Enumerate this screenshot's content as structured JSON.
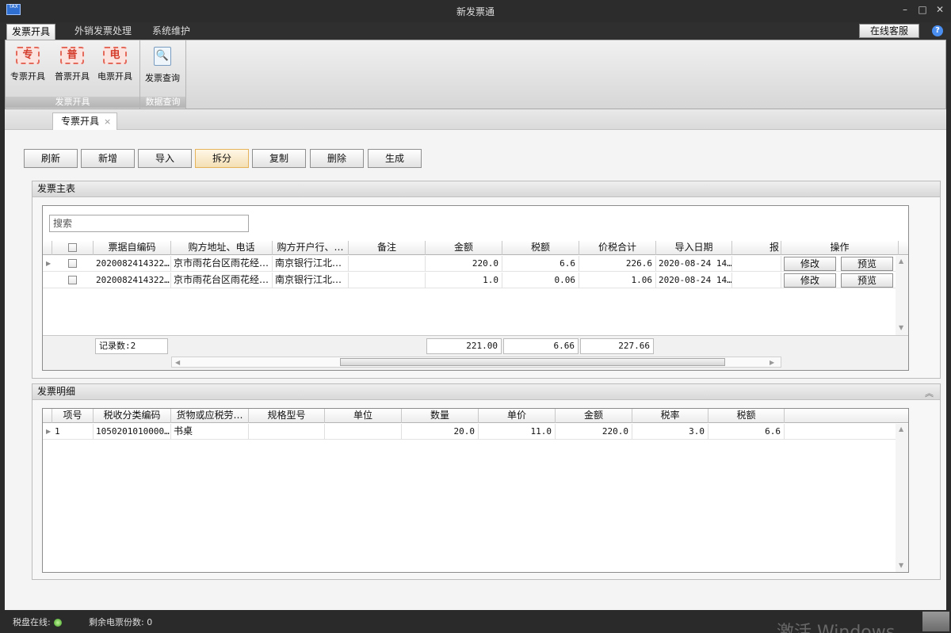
{
  "window": {
    "title": "新发票通",
    "min": "–",
    "max": "□",
    "close": "✕",
    "logo": "TAX"
  },
  "menu": {
    "tabs": [
      "发票开具",
      "外销发票处理",
      "系统维护"
    ],
    "online_service": "在线客服",
    "help": "?"
  },
  "ribbon": {
    "groups": [
      {
        "label": "发票开具",
        "buttons": [
          {
            "icon_text": "专",
            "label": "专票开具"
          },
          {
            "icon_text": "普",
            "label": "普票开具"
          },
          {
            "icon_text": "电",
            "label": "电票开具"
          }
        ]
      },
      {
        "label": "数据查询",
        "buttons": [
          {
            "icon_text": "🔍",
            "label": "发票查询"
          }
        ]
      }
    ]
  },
  "doc_tab": {
    "label": "专票开具",
    "close": "×"
  },
  "toolbar": [
    "刷新",
    "新增",
    "导入",
    "拆分",
    "复制",
    "删除",
    "生成"
  ],
  "master": {
    "title": "发票主表",
    "search_placeholder": "搜索",
    "columns": [
      "票据自编码",
      "购方地址、电话",
      "购方开户行、…",
      "备注",
      "金额",
      "税额",
      "价税合计",
      "导入日期",
      "报",
      "操作"
    ],
    "rows": [
      {
        "code": "2020082414322…",
        "addr": "京市雨花台区雨花经…",
        "bank": "南京银行江北…",
        "note": "",
        "amount": "220.0",
        "tax": "6.6",
        "total": "226.6",
        "date": "2020-08-24 14…",
        "edit": "修改",
        "preview": "预览"
      },
      {
        "code": "2020082414322…",
        "addr": "京市雨花台区雨花经…",
        "bank": "南京银行江北…",
        "note": "",
        "amount": "1.0",
        "tax": "0.06",
        "total": "1.06",
        "date": "2020-08-24 14…",
        "edit": "修改",
        "preview": "预览"
      }
    ],
    "footer": {
      "count": "记录数:2",
      "amount": "221.00",
      "tax": "6.66",
      "total": "227.66"
    }
  },
  "detail": {
    "title": "发票明细",
    "collapse": "︽",
    "columns": [
      "项号",
      "税收分类编码",
      "货物或应税劳…",
      "规格型号",
      "单位",
      "数量",
      "单价",
      "金额",
      "税率",
      "税额"
    ],
    "rows": [
      {
        "no": "1",
        "code": "1050201010000…",
        "goods": "书桌",
        "spec": "",
        "unit": "",
        "qty": "20.0",
        "price": "11.0",
        "amount": "220.0",
        "rate": "3.0",
        "tax": "6.6"
      }
    ]
  },
  "status": {
    "disk_online": "税盘在线:",
    "remaining": "剩余电票份数: 0"
  },
  "watermark": "激活 Windows"
}
